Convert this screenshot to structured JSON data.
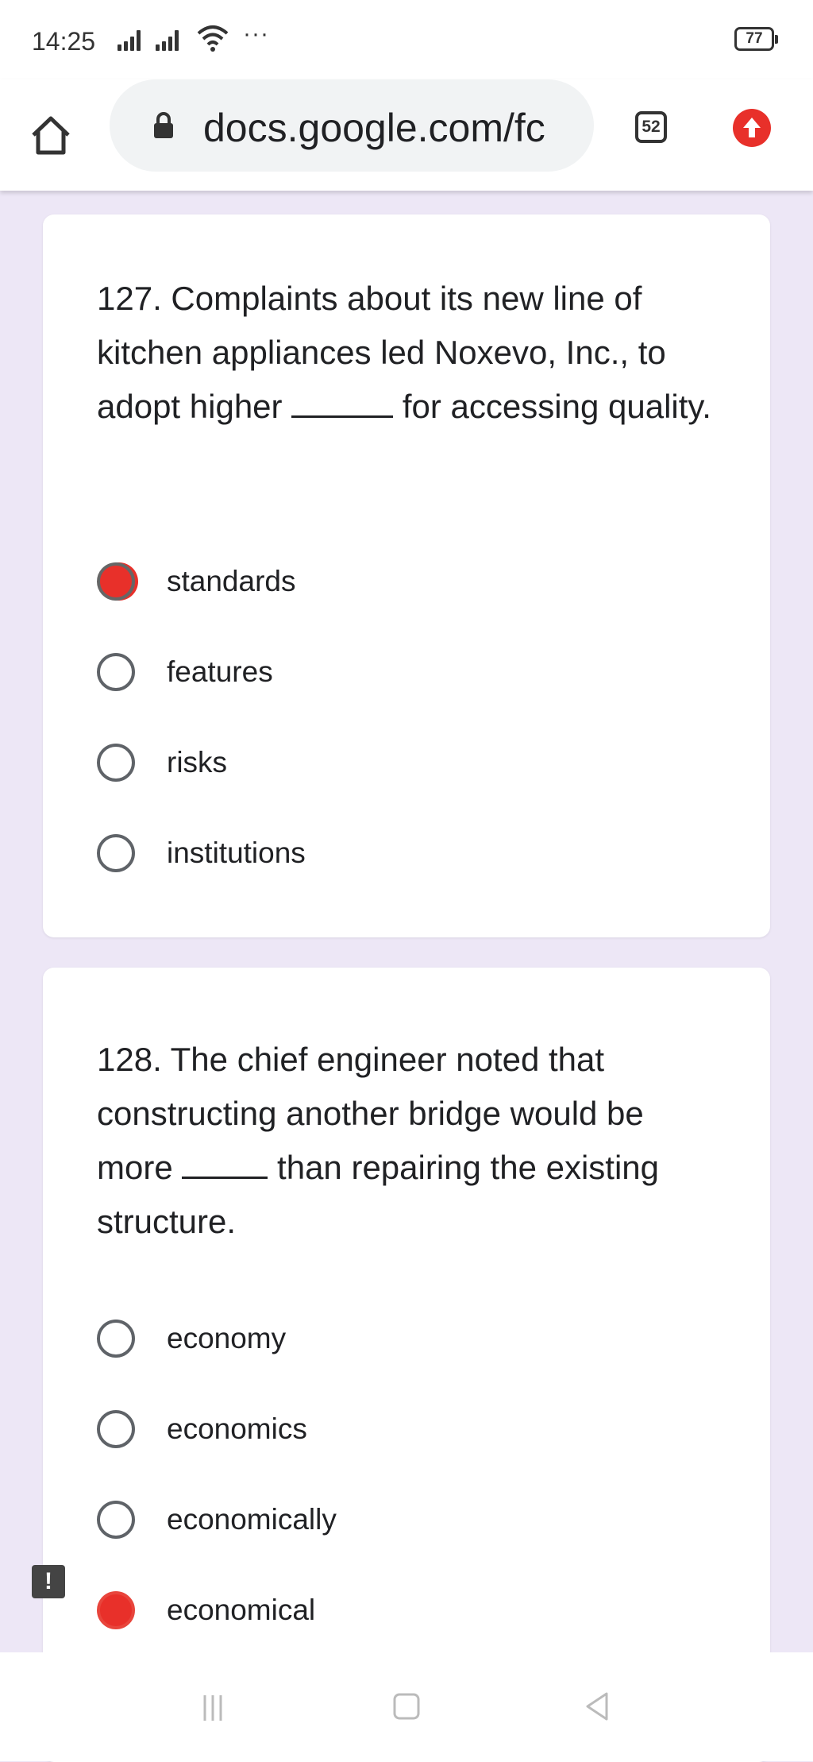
{
  "status_bar": {
    "time": "14:25",
    "more": "···",
    "battery": "77"
  },
  "toolbar": {
    "url": "docs.google.com/fc",
    "tab_count": "52"
  },
  "questions": [
    {
      "text_before": "127. Complaints about its new line of kitchen appliances led Noxevo, Inc., to adopt higher",
      "text_after": "for accessing quality.",
      "options": [
        {
          "label": "standards",
          "selected": true
        },
        {
          "label": "features",
          "selected": false
        },
        {
          "label": "risks",
          "selected": false
        },
        {
          "label": "institutions",
          "selected": false
        }
      ]
    },
    {
      "text_before": "128. The chief engineer noted that constructing another bridge would be more",
      "text_after": "than repairing the existing structure.",
      "options": [
        {
          "label": "economy",
          "selected": false
        },
        {
          "label": "economics",
          "selected": false
        },
        {
          "label": "economically",
          "selected": false
        },
        {
          "label": "economical",
          "selected": true
        }
      ]
    }
  ],
  "colors": {
    "accent": "#e8302a",
    "background": "#ede7f6"
  },
  "icons": [
    "home-icon",
    "lock-icon",
    "tabs-icon",
    "update-icon",
    "report-icon",
    "menu-nav-icon",
    "home-nav-icon",
    "back-nav-icon"
  ]
}
